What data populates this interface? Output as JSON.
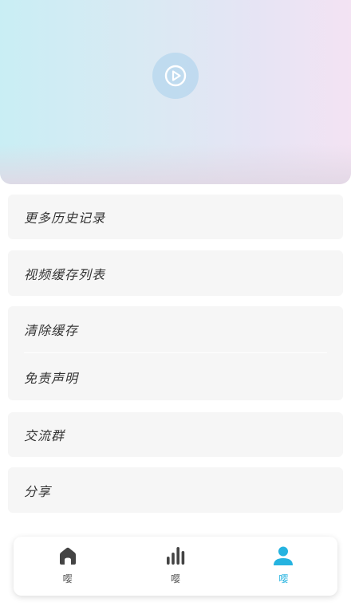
{
  "hero": {
    "icon": "play-circle-icon"
  },
  "menu": {
    "history": "更多历史记录",
    "cache_list": "视频缓存列表",
    "clear_cache": "清除缓存",
    "disclaimer": "免责声明",
    "group": "交流群",
    "share": "分享"
  },
  "tabbar": {
    "items": [
      {
        "label": "嘤",
        "icon": "home-icon"
      },
      {
        "label": "嘤",
        "icon": "bar-chart-icon"
      },
      {
        "label": "嘤",
        "icon": "user-icon"
      }
    ],
    "active_index": 2
  },
  "colors": {
    "accent": "#25b3e0",
    "inactive_icon": "#444444",
    "card_bg": "#f6f6f6"
  }
}
